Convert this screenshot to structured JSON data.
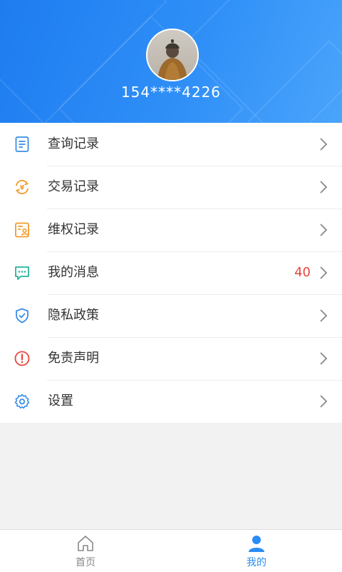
{
  "profile": {
    "phone": "154****4226"
  },
  "menu": {
    "items": [
      {
        "label": "查询记录",
        "icon": "document-icon",
        "badge": ""
      },
      {
        "label": "交易记录",
        "icon": "yuan-exchange-icon",
        "badge": ""
      },
      {
        "label": "维权记录",
        "icon": "rights-certificate-icon",
        "badge": ""
      },
      {
        "label": "我的消息",
        "icon": "message-icon",
        "badge": "40"
      },
      {
        "label": "隐私政策",
        "icon": "shield-check-icon",
        "badge": ""
      },
      {
        "label": "免责声明",
        "icon": "alert-circle-icon",
        "badge": ""
      },
      {
        "label": "设置",
        "icon": "gear-icon",
        "badge": ""
      }
    ]
  },
  "tabbar": {
    "home_label": "首页",
    "mine_label": "我的"
  },
  "colors": {
    "header_start": "#1e7cf0",
    "header_end": "#4aa4fb",
    "active_tab": "#2a8cf4",
    "inactive_tab": "#888888",
    "badge": "#e8453c",
    "icon_blue": "#3a8ee6",
    "icon_orange": "#f39a2b",
    "icon_teal": "#27b59b",
    "icon_red": "#e8453c"
  }
}
